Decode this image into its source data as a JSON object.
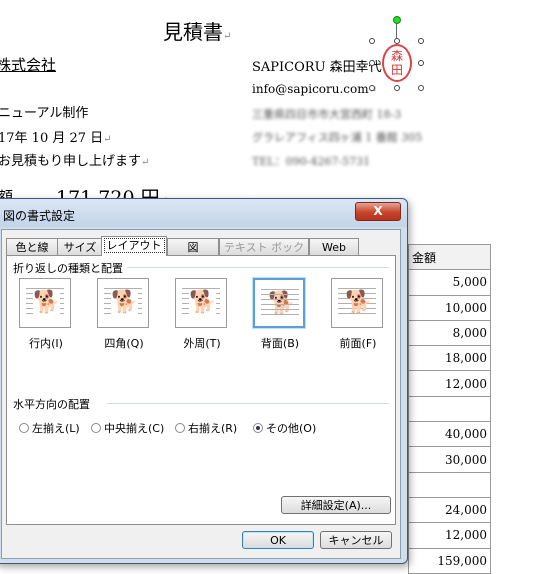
{
  "document": {
    "title": "見積書",
    "company": "株式会社",
    "lines": [
      "ニューアル制作",
      "17年 10 月 27 日",
      "お見積もり申し上げます"
    ],
    "sender": "SAPICORU 森田幸代",
    "email": "info@sapicoru.com",
    "address_blurred": [
      "三重県四日市市大宮西町 18-3",
      "グラレアフィス四ヶ浦 1 番館 305",
      "TEL：090-4267-5731"
    ],
    "amount_label": "額",
    "amount_value": "171,720 円",
    "paragraph_mark": "↵",
    "seal_text": [
      "森",
      "田"
    ]
  },
  "amount_table": {
    "header": "金額",
    "rows": [
      "5,000",
      "10,000",
      "8,000",
      "18,000",
      "12,000",
      "",
      "40,000",
      "30,000",
      "",
      "24,000",
      "12,000",
      "159,000"
    ]
  },
  "dialog": {
    "title": "図の書式設定",
    "close_label": "X",
    "tabs": [
      {
        "label": "色と線",
        "state": "normal"
      },
      {
        "label": "サイズ",
        "state": "normal"
      },
      {
        "label": "レイアウト",
        "state": "active"
      },
      {
        "label": "図",
        "state": "normal"
      },
      {
        "label": "テキスト ボックス",
        "state": "disabled"
      },
      {
        "label": "Web",
        "state": "normal"
      }
    ],
    "wrap_section": "折り返しの種類と配置",
    "wrap_options": [
      {
        "label": "行内(I)",
        "icon": "dog-inline-icon",
        "selected": false
      },
      {
        "label": "四角(Q)",
        "icon": "dog-square-icon",
        "selected": false
      },
      {
        "label": "外周(T)",
        "icon": "dog-tight-icon",
        "selected": false
      },
      {
        "label": "背面(B)",
        "icon": "dog-behind-icon",
        "selected": true
      },
      {
        "label": "前面(F)",
        "icon": "dog-front-icon",
        "selected": false
      }
    ],
    "align_section": "水平方向の配置",
    "align_options": [
      {
        "label": "左揃え(L)",
        "checked": false
      },
      {
        "label": "中央揃え(C)",
        "checked": false
      },
      {
        "label": "右揃え(R)",
        "checked": false
      },
      {
        "label": "その他(O)",
        "checked": true
      }
    ],
    "advanced_button": "詳細設定(A)...",
    "ok_button": "OK",
    "cancel_button": "キャンセル"
  },
  "colors": {
    "seal": "#dd3333",
    "accent_border": "#5aa0d8",
    "close_button": "#c8442b"
  }
}
